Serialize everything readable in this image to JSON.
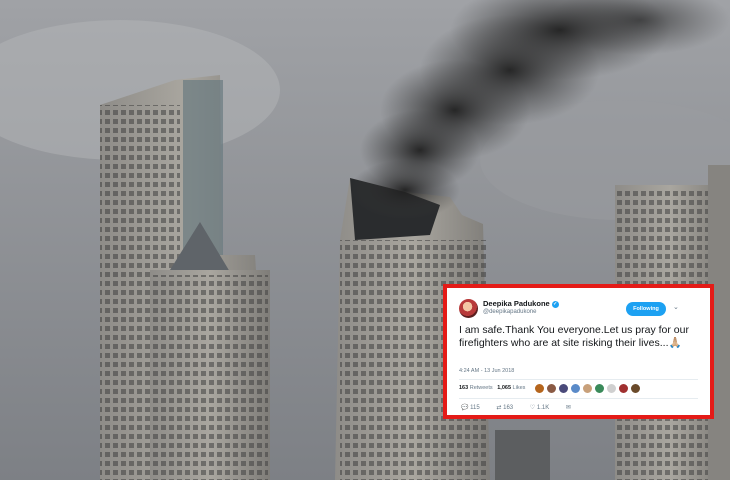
{
  "tweet": {
    "name": "Deepika Padukone",
    "handle": "@deepikapadukone",
    "follow_label": "Following",
    "text": "I am safe.Thank You everyone.Let us pray for our firefighters who are at site risking their lives...🙏🏼",
    "timestamp": "4:24 AM - 13 Jun 2018",
    "retweets_count": "163",
    "retweets_label": "Retweets",
    "likes_count": "1,065",
    "likes_label": "Likes",
    "reply_count": "115",
    "retweet_action_count": "163",
    "like_action_count": "1.1K"
  },
  "colors": {
    "frame_border": "#e41b17",
    "twitter_blue": "#1da1f2",
    "smoke": "#2b2b2b",
    "sky": "#8d9095"
  }
}
